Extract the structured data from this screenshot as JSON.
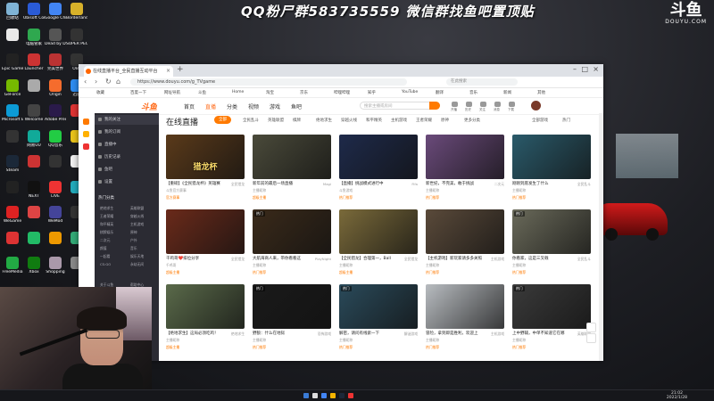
{
  "overlay": {
    "banner": "QQ粉尸群583735559 微信群找鱼吧置顶贴",
    "logo_main": "斗鱼",
    "logo_sub": "DOUYU.COM"
  },
  "desktop_icons": [
    {
      "label": "回收站",
      "color": "#7fb3d5"
    },
    {
      "label": "Ubisoft Connect",
      "color": "#2a5bd7"
    },
    {
      "label": "Google Chrome",
      "color": "#4285f4"
    },
    {
      "label": "Borderlands",
      "color": "#d7b12a"
    },
    {
      "label": "",
      "color": "#e9e9e9"
    },
    {
      "label": "电脑管家",
      "color": "#2fa84f"
    },
    {
      "label": "Dead by Daylight",
      "color": "#555"
    },
    {
      "label": "SUPER PEOPLE",
      "color": "#333"
    },
    {
      "label": "Epic Games",
      "color": "#222"
    },
    {
      "label": "Launcher",
      "color": "#c33"
    },
    {
      "label": "完美世界",
      "color": "#b33"
    },
    {
      "label": "OBS",
      "color": "#333"
    },
    {
      "label": "GeForce",
      "color": "#76b900"
    },
    {
      "label": "",
      "color": "#aaa"
    },
    {
      "label": "Origin",
      "color": "#f56c2d"
    },
    {
      "label": "迅雷",
      "color": "#2d8cf0"
    },
    {
      "label": "Microsoft Edge",
      "color": "#0c9bd6"
    },
    {
      "label": "Welcome",
      "color": "#444"
    },
    {
      "label": "Adobe Premiere",
      "color": "#2a1a4a"
    },
    {
      "label": "",
      "color": "#d33"
    },
    {
      "label": "",
      "color": "#333"
    },
    {
      "label": "网易UU",
      "color": "#1a9"
    },
    {
      "label": "QQ音乐",
      "color": "#2c4"
    },
    {
      "label": "",
      "color": "#e8c21a"
    },
    {
      "label": "Steam",
      "color": "#1b2838"
    },
    {
      "label": "",
      "color": "#c33"
    },
    {
      "label": "",
      "color": "#333"
    },
    {
      "label": "",
      "color": "#eee"
    },
    {
      "label": "",
      "color": "#222"
    },
    {
      "label": "NEXT",
      "color": "#111"
    },
    {
      "label": "LIVE",
      "color": "#e33"
    },
    {
      "label": "",
      "color": "#2ab"
    },
    {
      "label": "WeGame",
      "color": "#d22"
    },
    {
      "label": "",
      "color": "#d44"
    },
    {
      "label": "WeMod",
      "color": "#449"
    },
    {
      "label": "",
      "color": "#333"
    },
    {
      "label": "",
      "color": "#d33"
    },
    {
      "label": "",
      "color": "#2b6"
    },
    {
      "label": "",
      "color": "#e90"
    },
    {
      "label": "",
      "color": "#3a7"
    },
    {
      "label": "FreeMedia",
      "color": "#2a4"
    },
    {
      "label": "Xbox",
      "color": "#107c10"
    },
    {
      "label": "Shopping",
      "color": "#a9a"
    },
    {
      "label": "",
      "color": "#888"
    }
  ],
  "browser": {
    "tab_title": "在线直播平台_全民直播互动平台",
    "url": "https://www.douyu.com/g_TVgame",
    "search_placeholder": "在此搜索",
    "bookmarks": [
      "收藏",
      "百度一下",
      "网址导航",
      "斗鱼",
      "Home",
      "淘宝",
      "京东",
      "哔哩哔哩",
      "知乎",
      "YouTube",
      "翻译",
      "音乐",
      "新闻",
      "其他"
    ]
  },
  "site": {
    "logo": "斗鱼",
    "nav": [
      "首页",
      "直播",
      "分类",
      "视频",
      "游戏",
      "鱼吧"
    ],
    "search_placeholder": "搜索主播或房间",
    "header_icons": [
      "开播",
      "历史",
      "关注",
      "消息",
      "下载"
    ],
    "page_title": "在线直播",
    "filters": [
      "全部",
      "全民乱斗",
      "英雄联盟",
      "棋牌",
      "绝地求生",
      "穿越火线",
      "和平精英",
      "主机游戏",
      "王者荣耀",
      "原神",
      "更多分类"
    ],
    "right_filters": [
      "全部游戏",
      "热门"
    ]
  },
  "sidebar": {
    "items": [
      "我的关注",
      "我的订阅",
      "直播中",
      "历史记录",
      "鱼吧",
      "设置"
    ],
    "section_title": "热门分类",
    "grid": [
      "绝地求生",
      "英雄联盟",
      "王者荣耀",
      "穿越火线",
      "和平精英",
      "主机游戏",
      "棋牌娱乐",
      "原神",
      "二次元",
      "户外",
      "颜值",
      "音乐",
      "一起看",
      "娱乐天地",
      "CS:GO",
      "永劫无间"
    ],
    "footer": [
      "关于斗鱼",
      "帮助中心"
    ]
  },
  "cards": [
    {
      "title": "【重磅】《全民猎龙杯》英雄赛",
      "category": "全民猎龙",
      "meta": "斗鱼官方赛事",
      "tag": "官方赛事",
      "thumb": "#5a3a1a",
      "overlay": "猎龙杯",
      "badge": ""
    },
    {
      "title": "新年前的最后一场直播",
      "category": "Magi",
      "meta": "主播昵称",
      "tag": "超级主播",
      "thumb": "#4a4a3a",
      "overlay": "",
      "badge": ""
    },
    {
      "title": "【直播】挑战模式进行中",
      "category": "Fifa",
      "meta": "斗鱼游戏",
      "tag": "热门推荐",
      "thumb": "#1e2a4a",
      "overlay": "",
      "badge": ""
    },
    {
      "title": "新世纪，不完美，敢于挑战",
      "category": "二次元",
      "meta": "主播昵称",
      "tag": "热门推荐",
      "thumb": "#6a4a7a",
      "overlay": "",
      "badge": ""
    },
    {
      "title": "刚刚到底发生了什么",
      "category": "全民乱斗",
      "meta": "主播昵称",
      "tag": "热门推荐",
      "thumb": "#2a5a6a",
      "overlay": "",
      "badge": ""
    },
    {
      "title": "千鸡哥❤️排位分享",
      "category": "全民猎龙",
      "meta": "千鸡哥",
      "tag": "超级主播",
      "thumb": "#6a2a1a",
      "overlay": "",
      "badge": ""
    },
    {
      "title": "大航海商人来，带你看看这",
      "category": "PlayNight",
      "meta": "主播昵称",
      "tag": "热门推荐",
      "thumb": "#3a2a1a",
      "overlay": "",
      "badge": "热门"
    },
    {
      "title": "【全民猎龙】合理第一，Ball",
      "category": "全民猎龙",
      "meta": "主播昵称",
      "tag": "超级主播",
      "thumb": "#7a6a3a",
      "overlay": "",
      "badge": ""
    },
    {
      "title": "【主机游戏】新玩家请多多关照",
      "category": "主机游戏",
      "meta": "主播昵称",
      "tag": "热门推荐",
      "thumb": "#5a4a3a",
      "overlay": "",
      "badge": ""
    },
    {
      "title": "你看家，这是三叉戟",
      "category": "全民乱斗",
      "meta": "主播昵称",
      "tag": "热门推荐",
      "thumb": "#6a6a5a",
      "overlay": "",
      "badge": "热门"
    },
    {
      "title": "【绝地求生】这局必须吃鸡！",
      "category": "绝地求生",
      "meta": "主播昵称",
      "tag": "超级主播",
      "thumb": "#5a6a4a",
      "overlay": "",
      "badge": ""
    },
    {
      "title": "野狼：什么在地狱",
      "category": "恐怖游戏",
      "meta": "主播昵称",
      "tag": "热门推荐",
      "thumb": "#1a1a1a",
      "overlay": "",
      "badge": "热门"
    },
    {
      "title": "解密，请问有线索一下",
      "category": "解谜游戏",
      "meta": "主播昵称",
      "tag": "热门推荐",
      "thumb": "#2a4a5a",
      "overlay": "",
      "badge": "热门"
    },
    {
      "title": "冒险，拿到即是胜利，欢迎上",
      "category": "主机游戏",
      "meta": "主播昵称",
      "tag": "热门推荐",
      "thumb": "#b8bcc0",
      "overlay": "",
      "badge": ""
    },
    {
      "title": "上中野辅，中单不知道它在哪",
      "category": "英雄联盟",
      "meta": "主播昵称",
      "tag": "热门推荐",
      "thumb": "#3a3a3a",
      "overlay": "",
      "badge": "热门"
    }
  ],
  "taskbar": {
    "time": "21:02",
    "date": "2022/1/28"
  }
}
